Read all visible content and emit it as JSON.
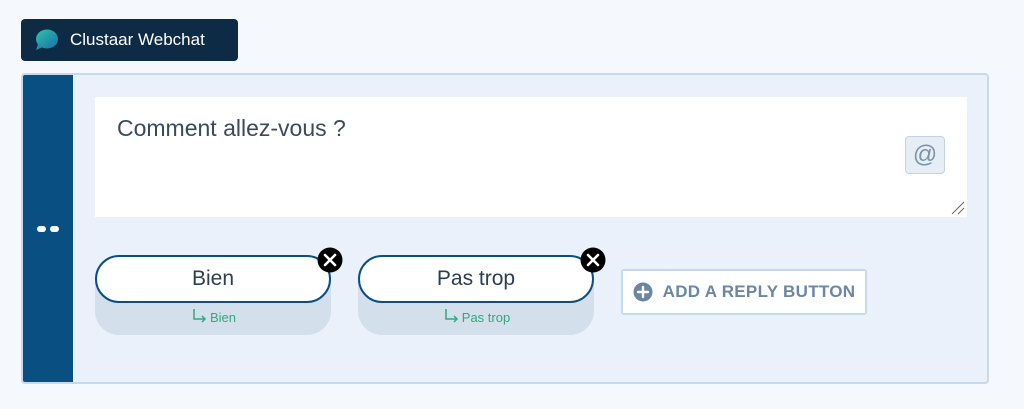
{
  "channel": {
    "label": "Clustaar Webchat",
    "icon": "chat-bubble-icon"
  },
  "message": {
    "text": "Comment allez-vous ?",
    "mention_button": "@"
  },
  "replies": [
    {
      "label": "Bien",
      "target": "Bien"
    },
    {
      "label": "Pas trop",
      "target": "Pas trop"
    }
  ],
  "add_reply": {
    "label": "ADD A REPLY BUTTON",
    "icon": "plus-circle-icon"
  },
  "colors": {
    "header_bg": "#0d2b45",
    "handle_bg": "#0a4f82",
    "pill_border": "#0a4f82",
    "target_green": "#2faa7a",
    "card_bg": "#eaf1fa"
  }
}
